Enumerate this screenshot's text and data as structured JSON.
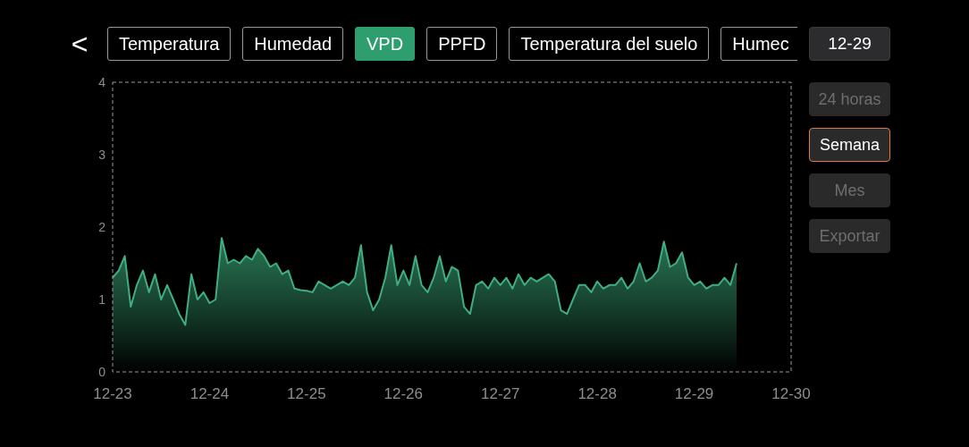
{
  "back_button": {
    "label": "<"
  },
  "tabs": [
    {
      "label": "Temperatura",
      "selected": false
    },
    {
      "label": "Humedad",
      "selected": false
    },
    {
      "label": "VPD",
      "selected": true
    },
    {
      "label": "PPFD",
      "selected": false
    },
    {
      "label": "Temperatura del suelo",
      "selected": false
    },
    {
      "label": "Humec",
      "selected": false
    }
  ],
  "date_button": {
    "label": "12-29"
  },
  "range_buttons": [
    {
      "label": "24 horas",
      "selected": false
    },
    {
      "label": "Semana",
      "selected": true
    },
    {
      "label": "Mes",
      "selected": false
    },
    {
      "label": "Exportar",
      "selected": false
    }
  ],
  "chart": {
    "chart_data": {
      "type": "area",
      "categories": [
        "12-23",
        null,
        null,
        null,
        null,
        null,
        null,
        null,
        null,
        null,
        null,
        null,
        null,
        null,
        null,
        null,
        "12-24",
        null,
        null,
        null,
        null,
        null,
        null,
        null,
        null,
        null,
        null,
        null,
        null,
        null,
        null,
        null,
        "12-25",
        null,
        null,
        null,
        null,
        null,
        null,
        null,
        null,
        null,
        null,
        null,
        null,
        null,
        null,
        null,
        "12-26",
        null,
        null,
        null,
        null,
        null,
        null,
        null,
        null,
        null,
        null,
        null,
        null,
        null,
        null,
        null,
        "12-27",
        null,
        null,
        null,
        null,
        null,
        null,
        null,
        null,
        null,
        null,
        null,
        null,
        null,
        null,
        null,
        "12-28",
        null,
        null,
        null,
        null,
        null,
        null,
        null,
        null,
        null,
        null,
        null,
        null,
        null,
        null,
        null,
        "12-29",
        null,
        null,
        null,
        null,
        null,
        null,
        null,
        null,
        null,
        null,
        null,
        null,
        null,
        null,
        null,
        "12-30"
      ],
      "series": [
        {
          "color": "#3fae82",
          "values": [
            1.3,
            1.4,
            1.6,
            0.9,
            1.2,
            1.4,
            1.1,
            1.35,
            1.0,
            1.2,
            1.0,
            0.8,
            0.65,
            1.35,
            1.0,
            1.1,
            0.95,
            1.0,
            1.85,
            1.5,
            1.55,
            1.5,
            1.6,
            1.55,
            1.7,
            1.6,
            1.45,
            1.5,
            1.35,
            1.4,
            1.15,
            1.13,
            1.12,
            1.1,
            1.25,
            1.2,
            1.15,
            1.2,
            1.25,
            1.2,
            1.3,
            1.75,
            1.1,
            0.85,
            1.0,
            1.3,
            1.75,
            1.2,
            1.4,
            1.2,
            1.6,
            1.2,
            1.1,
            1.3,
            1.6,
            1.25,
            1.45,
            1.4,
            0.9,
            0.8,
            1.2,
            1.25,
            1.15,
            1.3,
            1.2,
            1.3,
            1.15,
            1.35,
            1.2,
            1.3,
            1.25,
            1.3,
            1.35,
            1.25,
            0.85,
            0.8,
            1.0,
            1.2,
            1.2,
            1.1,
            1.25,
            1.15,
            1.2,
            1.2,
            1.3,
            1.15,
            1.25,
            1.5,
            1.25,
            1.3,
            1.4,
            1.8,
            1.45,
            1.5,
            1.65,
            1.3,
            1.2,
            1.25,
            1.15,
            1.2,
            1.2,
            1.3,
            1.2,
            1.5,
            null,
            null,
            null,
            null,
            null,
            null,
            null,
            null,
            null
          ]
        }
      ],
      "ylim": [
        0,
        4
      ],
      "yticks": [
        0,
        1,
        2,
        3,
        4
      ]
    }
  }
}
